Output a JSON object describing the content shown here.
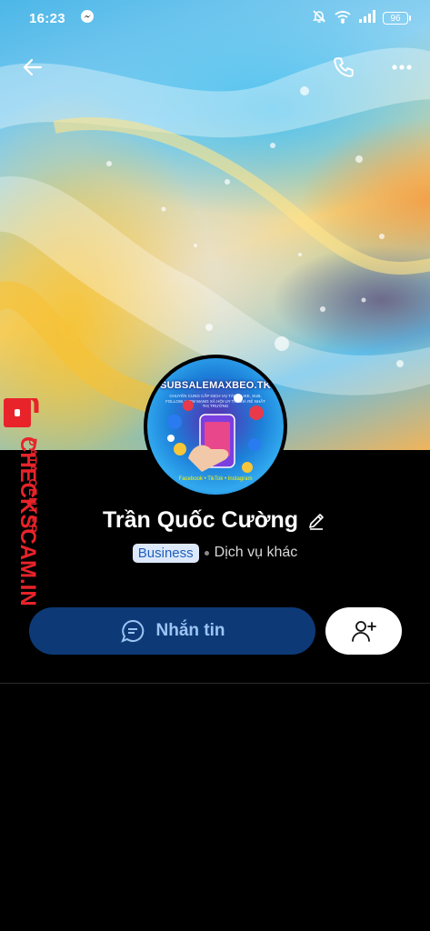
{
  "status_bar": {
    "time": "16:23",
    "battery": "96",
    "icons": [
      "messenger-icon",
      "bell-off-icon",
      "wifi-icon",
      "signal-icon",
      "battery-icon"
    ]
  },
  "header": {
    "back_icon": "arrow-left-icon",
    "call_icon": "phone-icon",
    "more_icon": "more-horizontal-icon"
  },
  "avatar": {
    "title": "SUBSALEMAXBEO.TK",
    "subtitle": "CHUYÊN CUNG CẤP DỊCH VỤ TĂNG LIKE, SUB, FOLLOW, VIEW MẠNG XÃ HỘI UY TÍN GIÁ RẺ NHẤT THỊ TRƯỜNG",
    "footer": "Facebook • TikTok • Instagram"
  },
  "watermark": {
    "line1": "DATA CENTER",
    "line2": "CHECKSCAM.INFO",
    "color": "#e8232a"
  },
  "profile": {
    "name": "Trần Quốc Cường",
    "badge": "Business",
    "category": "Dịch vụ khác"
  },
  "actions": {
    "message_label": "Nhắn tin",
    "message_icon": "chat-bubble-icon",
    "add_friend_icon": "user-plus-icon"
  },
  "colors": {
    "accent": "#0d3a76",
    "accent_text": "#9cc4f5",
    "badge_bg": "#dde9fb",
    "badge_text": "#1f5fbf"
  }
}
